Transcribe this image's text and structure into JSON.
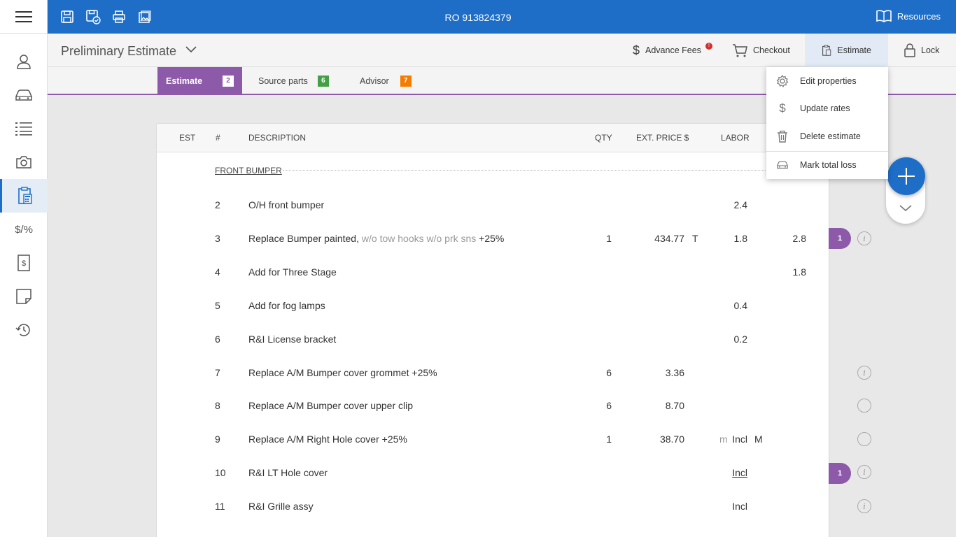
{
  "topbar": {
    "ro_title": "RO 913824379",
    "resources_label": "Resources",
    "icons": [
      "save-icon",
      "save-verify-icon",
      "print-icon",
      "image-icon"
    ]
  },
  "sidebar": {
    "items": [
      "user-icon",
      "car-icon",
      "list-icon",
      "camera-icon",
      "estimate-clipboard-icon",
      "rates-icon",
      "invoice-icon",
      "note-icon",
      "history-icon"
    ],
    "rates_glyph": "$/%",
    "active_index": 4
  },
  "header": {
    "page_title": "Preliminary Estimate",
    "advance_fees": "Advance Fees",
    "advance_fees_badge": "!",
    "checkout": "Checkout",
    "estimate": "Estimate",
    "lock": "Lock"
  },
  "tabs": [
    {
      "label": "Estimate",
      "count": "2",
      "color": "#8c5aa8"
    },
    {
      "label": "Source parts",
      "count": "6",
      "color": "#43a047"
    },
    {
      "label": "Advisor",
      "count": "7",
      "color": "#f57c00"
    }
  ],
  "table": {
    "headers": {
      "est": "EST",
      "num": "#",
      "description": "DESCRIPTION",
      "qty": "QTY",
      "ext_price": "EXT. PRICE $",
      "labor": "LABOR"
    },
    "section": "FRONT BUMPER",
    "rows": [
      {
        "num": "2",
        "desc": "O/H front bumper",
        "labor": "2.4"
      },
      {
        "num": "3",
        "desc": "Replace Bumper painted,",
        "desc_muted": "w/o tow hooks w/o prk sns",
        "desc_suffix": "+25%",
        "qty": "1",
        "price": "434.77",
        "flag": "T",
        "labor": "1.8",
        "paint": "2.8",
        "pill": "1",
        "info": true
      },
      {
        "num": "4",
        "desc": "Add for Three Stage",
        "paint": "1.8"
      },
      {
        "num": "5",
        "desc": "Add for fog lamps",
        "labor": "0.4"
      },
      {
        "num": "6",
        "desc": "R&I License bracket",
        "labor": "0.2"
      },
      {
        "num": "7",
        "desc": "Replace A/M Bumper cover grommet +25%",
        "qty": "6",
        "price": "3.36",
        "info": true
      },
      {
        "num": "8",
        "desc": "Replace A/M Bumper cover upper clip",
        "qty": "6",
        "price": "8.70",
        "empty_circle": true
      },
      {
        "num": "9",
        "desc": "Replace A/M Right Hole cover +25%",
        "qty": "1",
        "price": "38.70",
        "m": "m",
        "labor": "Incl",
        "mflag": "M",
        "empty_circle": true
      },
      {
        "num": "10",
        "desc": "R&I LT Hole cover",
        "labor": "Incl",
        "pill": "1",
        "info": true
      },
      {
        "num": "11",
        "desc": "R&I Grille assy",
        "labor": "Incl",
        "info": true
      }
    ]
  },
  "dropdown": {
    "items": [
      {
        "label": "Edit properties",
        "icon": "gear-icon"
      },
      {
        "label": "Update rates",
        "icon": "dollar-icon"
      },
      {
        "label": "Delete estimate",
        "icon": "trash-icon"
      },
      {
        "label": "Mark total loss",
        "icon": "car-loss-icon"
      }
    ]
  },
  "colors": {
    "brand_blue": "#1e6ec8",
    "estimate_purple": "#8c5aa8",
    "source_green": "#43a047",
    "advisor_orange": "#f57c00",
    "alert_red": "#d32f2f"
  }
}
